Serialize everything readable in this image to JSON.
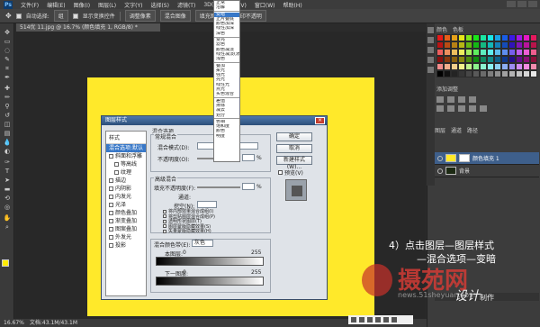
{
  "app": {
    "logo": "Ps",
    "menu": [
      "文件(F)",
      "编辑(E)",
      "图像(I)",
      "图层(L)",
      "文字(Y)",
      "选择(S)",
      "滤镜(T)",
      "3D(D)",
      "视图(V)",
      "窗口(W)",
      "帮助(H)"
    ]
  },
  "options": {
    "auto_select": "自动选择:",
    "target": "组",
    "show_transform": "显示变换控件",
    "buttons": [
      "调整像素",
      "混合图像",
      "填充图像",
      "打印不透明"
    ]
  },
  "document": {
    "tab": "514优 11.jpg @ 16.7% (颜色填充 1, RGB/8) *",
    "canvas_color": "#ffe92a"
  },
  "status": {
    "zoom": "16.67%",
    "doc_info": "文档:43.1M/43.1M"
  },
  "panels": {
    "tabs": [
      "颜色",
      "色板"
    ],
    "adjust_title": "添加调整",
    "layer_tabs": [
      "图层",
      "通道",
      "路径"
    ]
  },
  "layers": [
    {
      "name": "颜色填充 1",
      "active": true
    },
    {
      "name": "背景",
      "active": false
    }
  ],
  "dialog": {
    "title": "图层样式",
    "close": "×",
    "styles_header": "样式",
    "styles": [
      {
        "label": "混合选项:默认",
        "selected": true,
        "check": false,
        "sub": false
      },
      {
        "label": "斜面和浮雕",
        "selected": false,
        "check": true,
        "sub": false
      },
      {
        "label": "等高线",
        "selected": false,
        "check": true,
        "sub": true
      },
      {
        "label": "纹理",
        "selected": false,
        "check": true,
        "sub": true
      },
      {
        "label": "描边",
        "selected": false,
        "check": true,
        "sub": false
      },
      {
        "label": "内阴影",
        "selected": false,
        "check": true,
        "sub": false
      },
      {
        "label": "内发光",
        "selected": false,
        "check": true,
        "sub": false
      },
      {
        "label": "光泽",
        "selected": false,
        "check": true,
        "sub": false
      },
      {
        "label": "颜色叠加",
        "selected": false,
        "check": true,
        "sub": false
      },
      {
        "label": "渐变叠加",
        "selected": false,
        "check": true,
        "sub": false
      },
      {
        "label": "图案叠加",
        "selected": false,
        "check": true,
        "sub": false
      },
      {
        "label": "外发光",
        "selected": false,
        "check": true,
        "sub": false
      },
      {
        "label": "投影",
        "selected": false,
        "check": true,
        "sub": false
      }
    ],
    "blend_options": "混合选项",
    "general_blend": "常规混合",
    "blend_mode_label": "混合模式(D):",
    "opacity_label": "不透明度(O):",
    "advanced_blend": "高级混合",
    "fill_opacity_label": "填充不透明度(F):",
    "channels_label": "通道:",
    "knockout_label": "挖空(N):",
    "pct": "%",
    "checks": [
      "将内部效果混合成组(I)",
      "将剪贴图层混合成组(P)",
      "透明形状图层(T)",
      "图层蒙版隐藏效果(S)",
      "矢量蒙版隐藏效果(H)"
    ],
    "blend_if_label": "混合颜色带(E):",
    "blend_if_value": "灰色",
    "this_layer": "本图层:",
    "under_layer": "下一图层:",
    "val0": "0",
    "val255": "255",
    "ok": "确定",
    "cancel": "取消",
    "new_style": "新建样式(W)...",
    "preview": "预览(V)"
  },
  "blend_menu": {
    "groups": [
      [
        "正常",
        "溶解"
      ],
      [
        "变暗",
        "正片叠底",
        "颜色加深",
        "线性加深",
        "深色"
      ],
      [
        "变亮",
        "滤色",
        "颜色减淡",
        "线性减淡(添加)",
        "浅色"
      ],
      [
        "叠加",
        "柔光",
        "强光",
        "亮光",
        "线性光",
        "点光",
        "实色混合"
      ],
      [
        "差值",
        "排除",
        "减去",
        "划分"
      ],
      [
        "色相",
        "饱和度",
        "颜色",
        "明度"
      ]
    ],
    "selected": "变暗"
  },
  "caption": {
    "line1": "4）点击图层—图层样式",
    "line2": "—混合选项—变暗"
  },
  "watermark": {
    "site": "摄苑网",
    "url": "news.51sheyuan.com"
  },
  "signature": {
    "text": "设计",
    "suffix": "制作"
  },
  "colors": {
    "accent": "#3878c8",
    "yellow": "#ffe92a"
  }
}
